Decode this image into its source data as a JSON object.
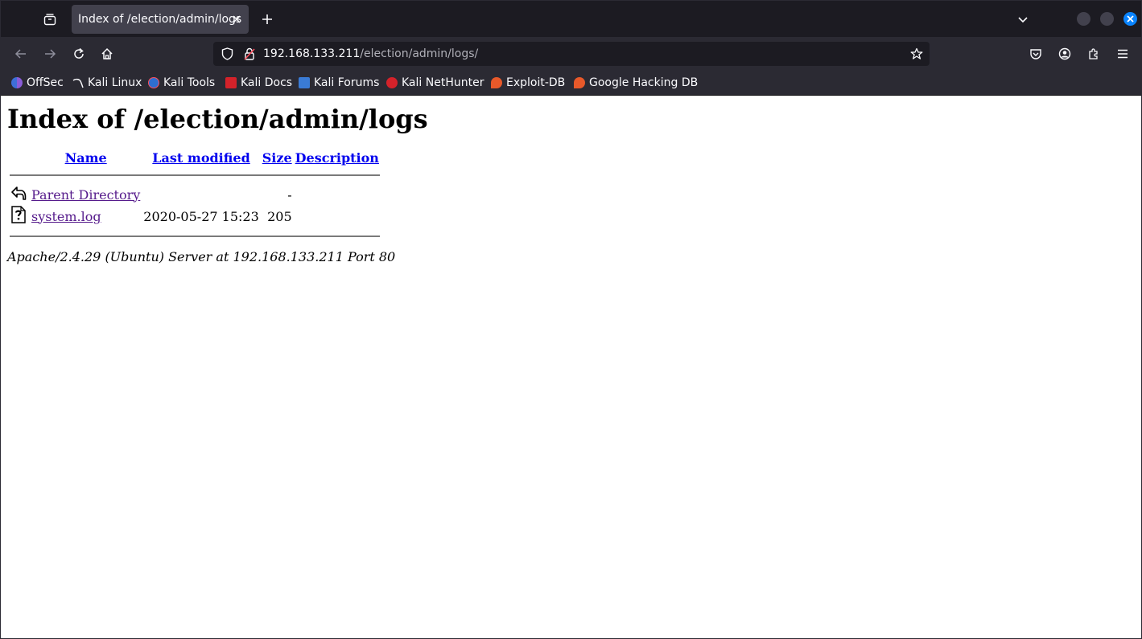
{
  "browser": {
    "tab": {
      "title": "Index of /election/admin/logs"
    },
    "url": {
      "host": "192.168.133.211",
      "path": "/election/admin/logs/"
    },
    "bookmarks": [
      {
        "label": "OffSec",
        "color": "#3d6fd8"
      },
      {
        "label": "Kali Linux",
        "color": "#2b2a33"
      },
      {
        "label": "Kali Tools",
        "color": "#2e6fd0"
      },
      {
        "label": "Kali Docs",
        "color": "#d4222a"
      },
      {
        "label": "Kali Forums",
        "color": "#3a7bd5"
      },
      {
        "label": "Kali NetHunter",
        "color": "#d4222a"
      },
      {
        "label": "Exploit-DB",
        "color": "#e8592a"
      },
      {
        "label": "Google Hacking DB",
        "color": "#e8592a"
      }
    ]
  },
  "page": {
    "title": "Index of /election/admin/logs",
    "columns": {
      "name": "Name",
      "modified": "Last modified",
      "size": "Size",
      "description": "Description"
    },
    "rows": [
      {
        "icon": "back-arrow-icon",
        "name": "Parent Directory",
        "modified": "",
        "size": "-",
        "description": ""
      },
      {
        "icon": "unknown-file-icon",
        "name": "system.log",
        "modified": "2020-05-27 15:23",
        "size": "205",
        "description": ""
      }
    ],
    "footer": "Apache/2.4.29 (Ubuntu) Server at 192.168.133.211 Port 80"
  },
  "colors": {
    "link": "#0000ee",
    "visited": "#551a8b",
    "chrome_dark": "#1c1b22",
    "chrome": "#2b2a33",
    "accent": "#0a84ff"
  }
}
